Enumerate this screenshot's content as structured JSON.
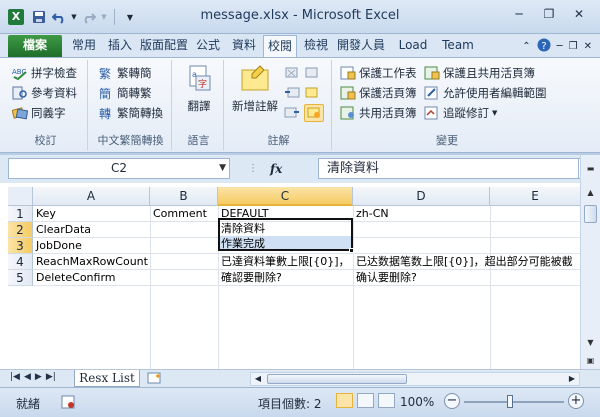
{
  "window": {
    "app_icon_letter": "X",
    "title": "message.xlsx - Microsoft Excel",
    "minimize": "─",
    "restore": "❐",
    "close": "✕"
  },
  "tabs": {
    "file": "檔案",
    "items": [
      "常用",
      "插入",
      "版面配置",
      "公式",
      "資料",
      "校閱",
      "檢視",
      "開發人員",
      "Load Test",
      "Team"
    ],
    "active": "校閱"
  },
  "ribbon": {
    "proofing": {
      "label": "校訂",
      "spelling": "拼字檢查",
      "research": "參考資料",
      "thesaurus": "同義字"
    },
    "chinese": {
      "label": "中文繁簡轉換",
      "to_traditional": "繁轉簡",
      "to_simplified": "簡轉繁",
      "conversion": "繁簡轉換"
    },
    "language": {
      "label": "語言",
      "translate": "翻譯"
    },
    "comments": {
      "label": "註解",
      "new_comment": "新增註解"
    },
    "changes": {
      "label": "變更",
      "protect_sheet": "保護工作表",
      "protect_workbook": "保護活頁簿",
      "share_workbook": "共用活頁簿",
      "protect_share": "保護且共用活頁簿",
      "allow_edit": "允許使用者編輯範圍",
      "track_changes": "追蹤修訂"
    }
  },
  "formula_bar": {
    "name_box": "C2",
    "fx": "fx",
    "content": "清除資料"
  },
  "grid": {
    "columns": [
      "A",
      "B",
      "C",
      "D",
      "E"
    ],
    "selected_column": "C",
    "rows": [
      {
        "num": "1",
        "a": "Key",
        "b": "Comment",
        "c": "DEFAULT",
        "d": "zh-CN"
      },
      {
        "num": "2",
        "a": "ClearData",
        "b": "",
        "c": "清除資料",
        "d": ""
      },
      {
        "num": "3",
        "a": "JobDone",
        "b": "",
        "c": "作業完成",
        "d": ""
      },
      {
        "num": "4",
        "a": "ReachMaxRowCount",
        "b": "",
        "c": "已達資料筆數上限[{0}]，",
        "d": "已达数据笔数上限[{0}]，超出部分可能被截"
      },
      {
        "num": "5",
        "a": "DeleteConfirm",
        "b": "",
        "c": "確認要刪除?",
        "d": "确认要删除?"
      }
    ]
  },
  "sheets": {
    "active": "Resx List"
  },
  "status": {
    "ready": "就緒",
    "count": "項目個數: 2",
    "zoom": "100%",
    "zoom_level_pct": 100
  }
}
